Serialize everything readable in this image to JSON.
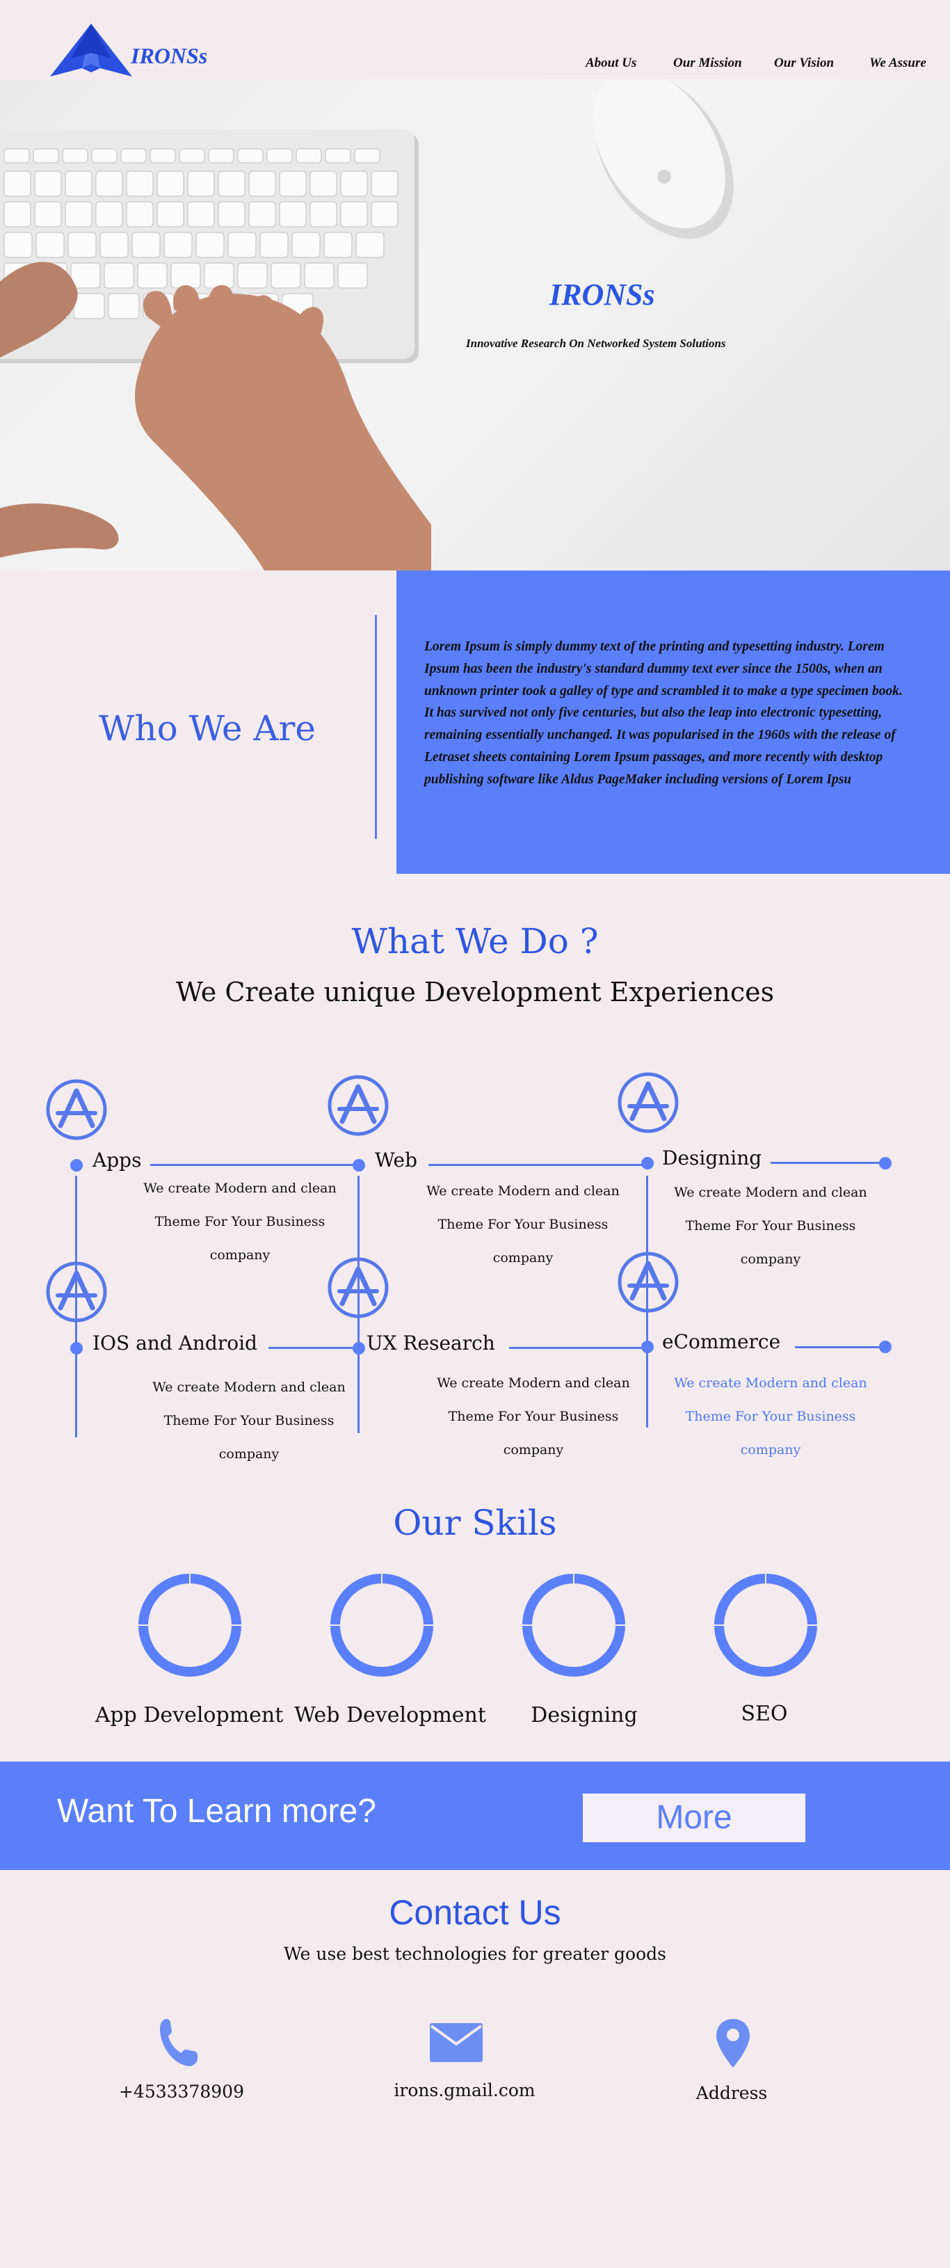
{
  "brand": {
    "name": "IRONSs"
  },
  "nav": [
    "About Us",
    "Our Mission",
    "Our Vision",
    "We Assure"
  ],
  "hero": {
    "title": "IRONSs",
    "subtitle": "Innovative Research On Networked System Solutions"
  },
  "who": {
    "title": "Who We Are",
    "text": "Lorem Ipsum is simply dummy text of the printing and typesetting industry. Lorem Ipsum has been the industry's standard dummy text ever since the 1500s, when an unknown printer took a galley of type and scrambled it to make a type specimen book. It has survived not only five centuries, but also the leap into electronic typesetting, remaining essentially unchanged. It was popularised in the 1960s with the release of Letraset sheets containing Lorem Ipsum passages, and more recently with desktop publishing software like Aldus PageMaker including versions of Lorem Ipsu"
  },
  "what": {
    "title": "What We Do ?",
    "subtitle": "We Create unique Development Experiences",
    "services": [
      {
        "name": "Apps",
        "desc": "We create Modern and clean Theme For Your Business company",
        "icon": "app-store-icon"
      },
      {
        "name": "Web",
        "desc": "We create Modern and clean Theme For Your Business company",
        "icon": "app-store-icon"
      },
      {
        "name": "Designing",
        "desc": "We create Modern and clean Theme For Your Business company",
        "icon": "app-store-icon"
      },
      {
        "name": "IOS and Android",
        "desc": "We create Modern and clean Theme For Your Business company",
        "icon": "app-store-icon"
      },
      {
        "name": "UX Research",
        "desc": "We create Modern and clean Theme For Your Business company",
        "icon": "app-store-icon"
      },
      {
        "name": "eCommerce",
        "desc": "We create Modern and clean Theme For Your Business company",
        "icon": "app-store-icon"
      }
    ]
  },
  "skills": {
    "title": "Our Skils",
    "items": [
      "App Development",
      "Web Development",
      "Designing",
      "SEO"
    ]
  },
  "cta": {
    "text": "Want To Learn more?",
    "button": "More"
  },
  "contact": {
    "title": "Contact Us",
    "subtitle": "We use best technologies for greater goods",
    "phone": "+4533378909",
    "email": "irons.gmail.com",
    "address": "Address"
  },
  "colors": {
    "accent": "#5b7ff9",
    "title_blue": "#2f55e0",
    "background": "#f3ebed"
  }
}
